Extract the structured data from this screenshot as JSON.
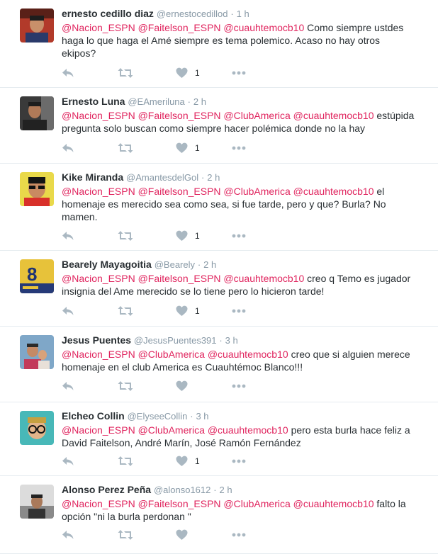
{
  "tweets": [
    {
      "name": "ernesto cedillo diaz",
      "handle": "@ernestocedillod",
      "sep": "·",
      "time": "1 h",
      "mentions": "@Nacion_ESPN @Faitelson_ESPN @cuauhtemocb10",
      "text": "Como siempre ustdes haga lo que haga el Amé siempre es tema polemico. Acaso no hay otros ekipos?",
      "likes": "1"
    },
    {
      "name": "Ernesto Luna",
      "handle": "@EAmeriluna",
      "sep": "·",
      "time": "2 h",
      "mentions": "@Nacion_ESPN @Faitelson_ESPN @ClubAmerica @cuauhtemocb10",
      "text": "estúpida pregunta solo buscan como siempre hacer polémica donde no la hay",
      "likes": "1"
    },
    {
      "name": "Kike Miranda",
      "handle": "@AmantesdelGol",
      "sep": "·",
      "time": "2 h",
      "mentions": "@Nacion_ESPN @Faitelson_ESPN @ClubAmerica @cuauhtemocb10",
      "text": "el homenaje es merecido sea como sea, si fue tarde, pero y que? Burla? No mamen.",
      "likes": "1"
    },
    {
      "name": "Bearely Mayagoitia",
      "handle": "@Bearely",
      "sep": "·",
      "time": "2 h",
      "mentions": "@Nacion_ESPN @Faitelson_ESPN @cuauhtemocb10",
      "text": "creo q Temo es jugador insignia del Ame merecido se lo tiene pero lo hicieron tarde!",
      "likes": "1"
    },
    {
      "name": "Jesus Puentes",
      "handle": "@JesusPuentes391",
      "sep": "·",
      "time": "3 h",
      "mentions": "@Nacion_ESPN @ClubAmerica @cuauhtemocb10",
      "text": "creo que si alguien merece homenaje en el club America es Cuauhtémoc Blanco!!!",
      "likes": ""
    },
    {
      "name": "Elcheo Collin",
      "handle": "@ElyseeCollin",
      "sep": "·",
      "time": "3 h",
      "mentions": "@Nacion_ESPN @ClubAmerica @cuauhtemocb10",
      "text": "pero esta burla hace feliz a David Faitelson, André Marín, José Ramón Fernández",
      "likes": "1"
    },
    {
      "name": "Alonso Perez Peña",
      "handle": "@alonso1612",
      "sep": "·",
      "time": "2 h",
      "mentions": "@Nacion_ESPN @Faitelson_ESPN @ClubAmerica @cuauhtemocb10",
      "text": "falto la opción \"ni la burla perdonan \"",
      "likes": ""
    }
  ],
  "icons": {
    "reply": "reply-icon",
    "retweet": "retweet-icon",
    "like": "heart-icon",
    "more": "more-icon"
  },
  "colors": {
    "mention": "#e0245e",
    "meta": "#8899a6",
    "icon": "#aab8c2",
    "divider": "#e6ecf0"
  }
}
